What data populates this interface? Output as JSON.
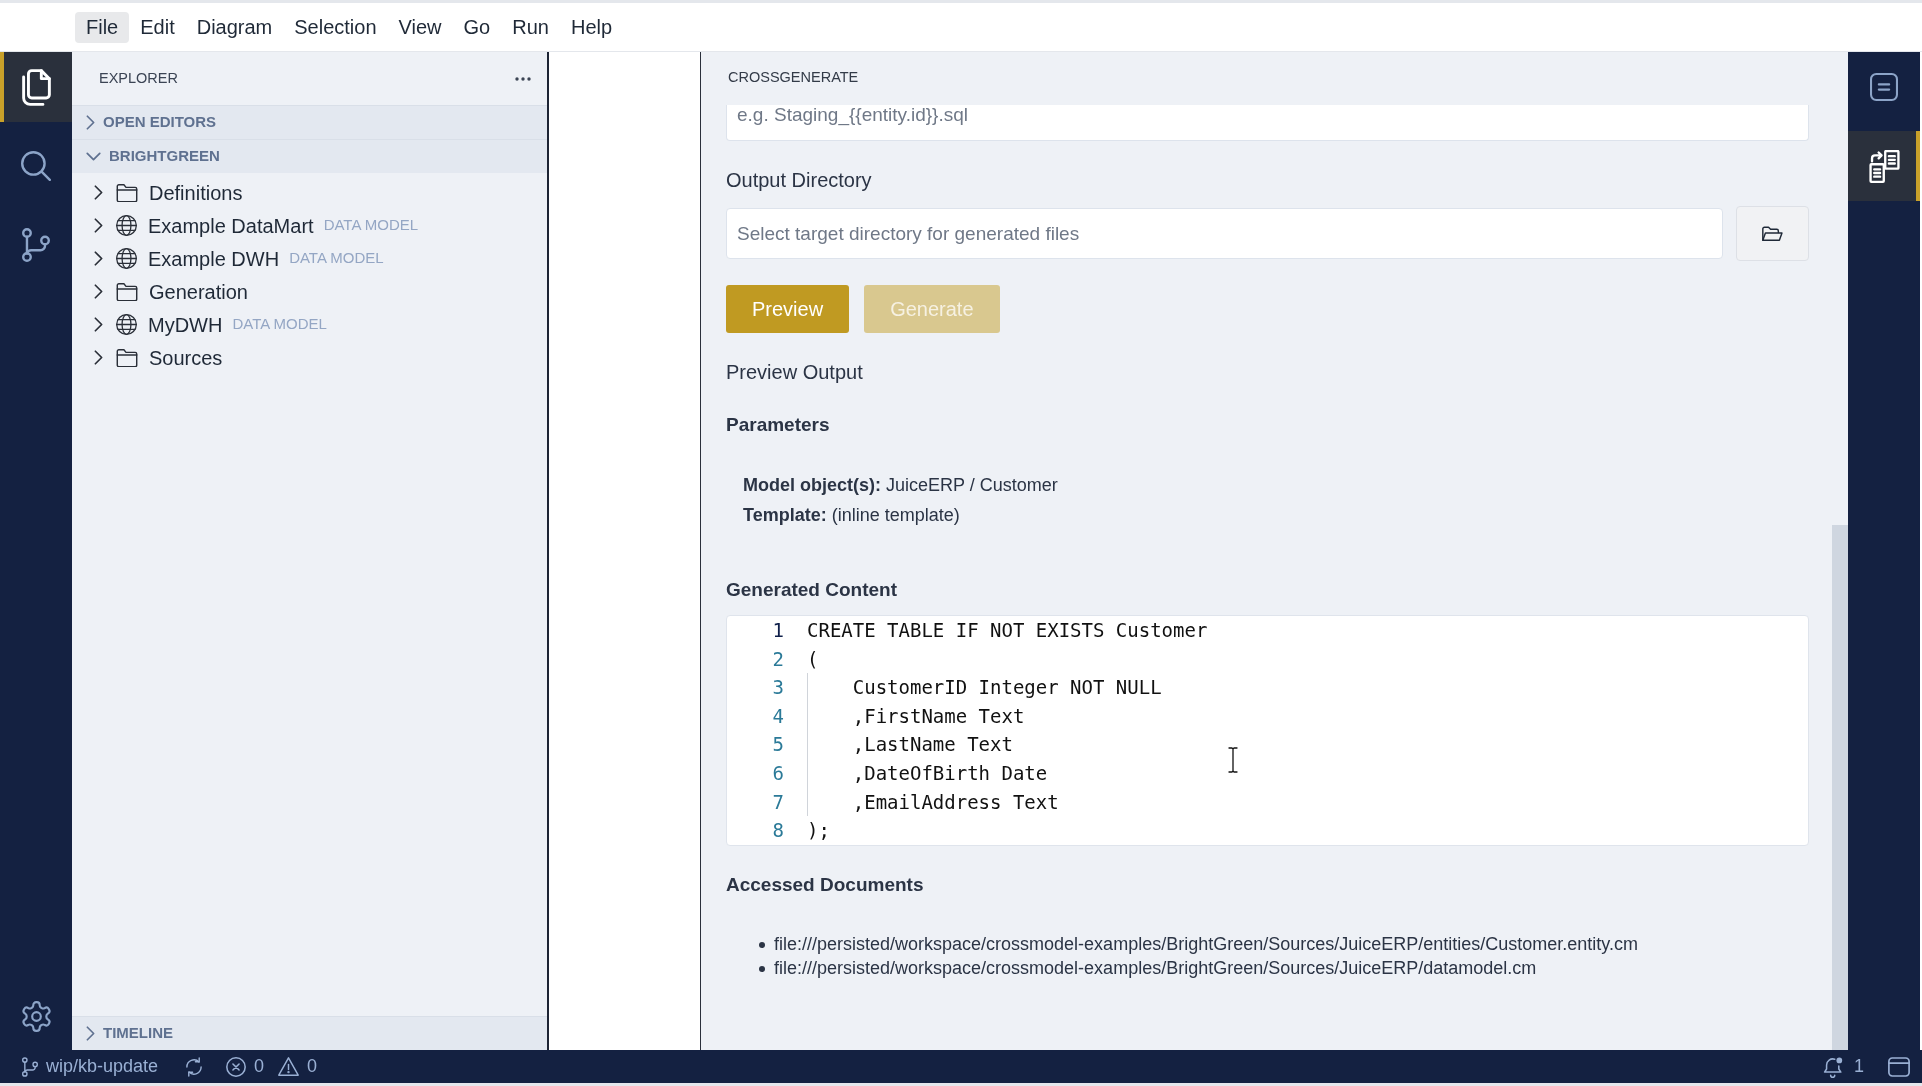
{
  "menu_bar": {
    "items": [
      {
        "label": "File",
        "selected": true
      },
      {
        "label": "Edit",
        "selected": false
      },
      {
        "label": "Diagram",
        "selected": false
      },
      {
        "label": "Selection",
        "selected": false
      },
      {
        "label": "View",
        "selected": false
      },
      {
        "label": "Go",
        "selected": false
      },
      {
        "label": "Run",
        "selected": false
      },
      {
        "label": "Help",
        "selected": false
      }
    ]
  },
  "activity_bar": {
    "items": [
      {
        "kind": "files",
        "selected": true
      },
      {
        "kind": "search",
        "selected": false
      },
      {
        "kind": "source-control",
        "selected": false
      }
    ]
  },
  "sidebar": {
    "title": "EXPLORER",
    "sections": [
      {
        "title": "OPEN EDITORS",
        "expanded": false
      },
      {
        "title": "BRIGHTGREEN",
        "expanded": true,
        "items": [
          {
            "label": "Definitions",
            "kind": "folder",
            "expanded": false
          },
          {
            "label": "Example DataMart",
            "kind": "model",
            "badge": "DATA MODEL",
            "expanded": false
          },
          {
            "label": "Example DWH",
            "kind": "model",
            "badge": "DATA MODEL",
            "expanded": false
          },
          {
            "label": "Generation",
            "kind": "folder",
            "expanded": false
          },
          {
            "label": "MyDWH",
            "kind": "model",
            "badge": "DATA MODEL",
            "expanded": false
          },
          {
            "label": "Sources",
            "kind": "folder",
            "expanded": false
          }
        ]
      },
      {
        "title": "TIMELINE",
        "expanded": false
      }
    ]
  },
  "panel": {
    "title": "CROSSGENERATE",
    "fields": [
      {
        "kind": "text",
        "placeholder": "e.g. Staging_{{entity.id}}.sql"
      },
      {
        "kind": "directory",
        "label": "Output Directory",
        "placeholder": "Select target directory for generated files"
      }
    ],
    "buttons": [
      {
        "label": "Preview",
        "disabled": false
      },
      {
        "label": "Generate",
        "disabled": true
      }
    ],
    "preview_title": "Preview Output",
    "parameters": {
      "title": "Parameters",
      "lines": [
        "**Model object(s):** JuiceERP / Customer",
        "**Template:** (inline template)"
      ]
    },
    "generated_content": {
      "title": "Generated Content",
      "lines": [
        {
          "number": "1",
          "text": "CREATE TABLE IF NOT EXISTS Customer",
          "active": true
        },
        {
          "number": "2",
          "text": "(",
          "active": false
        },
        {
          "number": "3",
          "text": "    CustomerID Integer NOT NULL",
          "active": false
        },
        {
          "number": "4",
          "text": "    ,FirstName Text",
          "active": false
        },
        {
          "number": "5",
          "text": "    ,LastName Text",
          "active": false
        },
        {
          "number": "6",
          "text": "    ,DateOfBirth Date",
          "active": false
        },
        {
          "number": "7",
          "text": "    ,EmailAddress Text",
          "active": false
        },
        {
          "number": "8",
          "text": ");",
          "active": false
        }
      ]
    },
    "accessed_documents": {
      "title": "Accessed Documents",
      "items": [
        "file:///persisted/workspace/crossmodel-examples/BrightGreen/Sources/JuiceERP/entities/Customer.entity.cm",
        "file:///persisted/workspace/crossmodel-examples/BrightGreen/Sources/JuiceERP/datamodel.cm"
      ]
    }
  },
  "right_activity_bar": {
    "items": [
      {
        "kind": "outline",
        "selected": false
      },
      {
        "kind": "generate",
        "selected": true
      }
    ]
  },
  "status_bar": {
    "branch": "wip/kb-update",
    "errors": "0",
    "warnings": "0",
    "notifications": "1"
  }
}
